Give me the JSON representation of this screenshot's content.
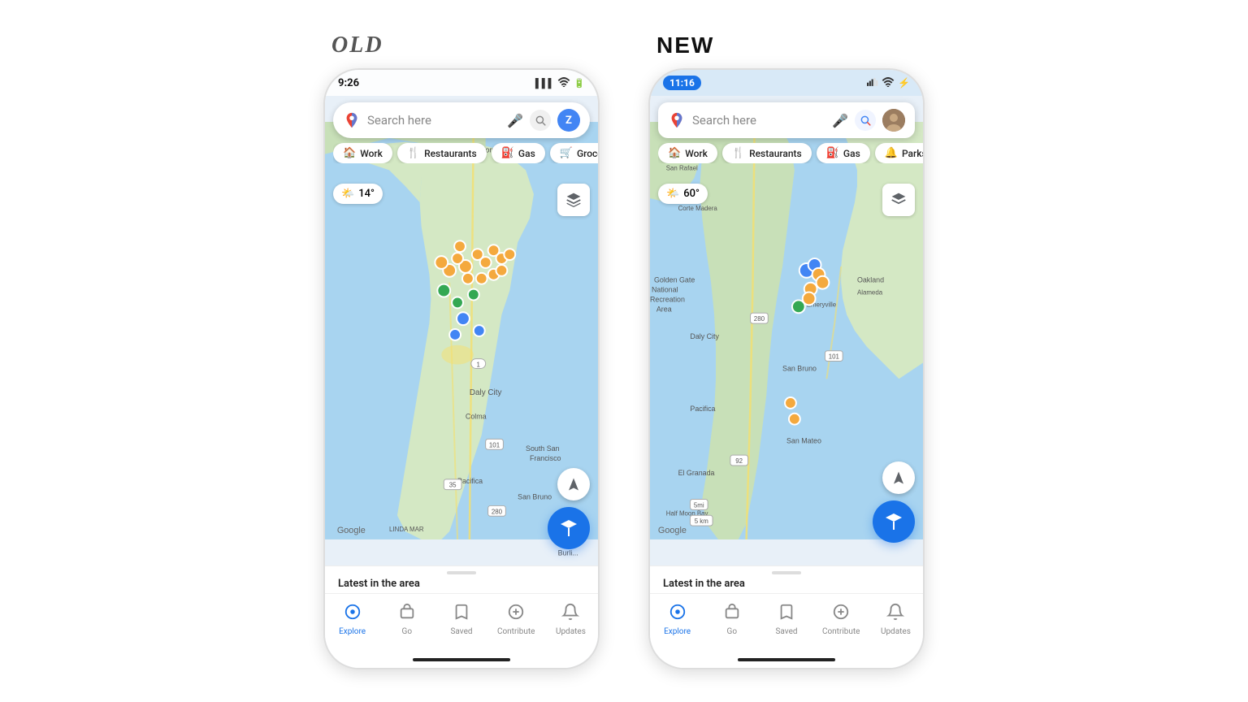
{
  "comparison": {
    "old_label": "OLD",
    "new_label": "NEW"
  },
  "old_version": {
    "status": {
      "time": "9:26",
      "signal": "▌▌▌",
      "wifi": "wifi",
      "battery": "battery"
    },
    "search": {
      "placeholder": "Search here",
      "has_mic": true,
      "has_lens": true,
      "avatar_initial": "Z"
    },
    "categories": [
      {
        "icon": "🏠",
        "label": "Work"
      },
      {
        "icon": "🍴",
        "label": "Restaurants"
      },
      {
        "icon": "⛽",
        "label": "Gas"
      },
      {
        "icon": "🛒",
        "label": "Grocerie"
      }
    ],
    "weather": {
      "icon": "🌤️",
      "temp": "14°"
    },
    "latest_area_text": "Latest in the area",
    "nav_items": [
      {
        "label": "Explore",
        "active": true
      },
      {
        "label": "Go",
        "active": false
      },
      {
        "label": "Saved",
        "active": false
      },
      {
        "label": "Contribute",
        "active": false
      },
      {
        "label": "Updates",
        "active": false
      }
    ],
    "google_text": "Google"
  },
  "new_version": {
    "status": {
      "time": "11:16",
      "signal": "▌▌▌",
      "wifi": "wifi",
      "battery": "battery"
    },
    "search": {
      "placeholder": "Search here",
      "has_mic": true,
      "has_lens": true,
      "has_avatar": true
    },
    "categories": [
      {
        "icon": "🏠",
        "label": "Work"
      },
      {
        "icon": "🍴",
        "label": "Restaurants"
      },
      {
        "icon": "⛽",
        "label": "Gas"
      },
      {
        "icon": "🔔",
        "label": "Parks"
      }
    ],
    "weather": {
      "icon": "🌤️",
      "temp": "60°"
    },
    "latest_area_text": "Latest in the area",
    "nav_items": [
      {
        "label": "Explore",
        "active": true
      },
      {
        "label": "Go",
        "active": false
      },
      {
        "label": "Saved",
        "active": false
      },
      {
        "label": "Contribute",
        "active": false
      },
      {
        "label": "Updates",
        "active": false
      }
    ],
    "google_text": "Google"
  }
}
